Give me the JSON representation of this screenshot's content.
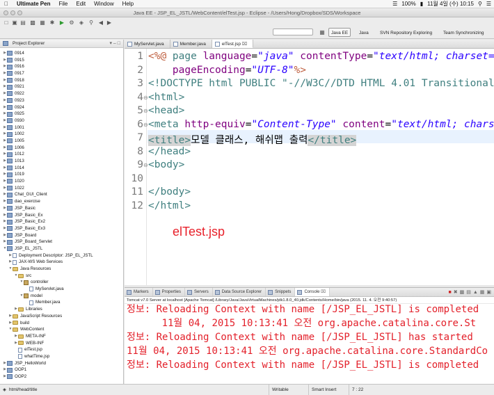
{
  "menubar": {
    "app": "Ultimate Pen",
    "items": [
      "File",
      "Edit",
      "Window",
      "Help"
    ],
    "battery": "100%",
    "datetime": "11월 4일 (수) 10:15"
  },
  "window": {
    "title": "Java EE - JSP_EL_JSTL/WebContent/elTest.jsp - Eclipse - /Users/Hong/Dropbox/SDS/Workspace"
  },
  "perspectives": [
    "Java EE",
    "Java",
    "SVN Repository Exploring",
    "Team Synchronizing"
  ],
  "explorer": {
    "title": "Project Explorer",
    "items": [
      {
        "label": "0914",
        "level": 0,
        "kind": "project"
      },
      {
        "label": "0915",
        "level": 0,
        "kind": "project"
      },
      {
        "label": "0916",
        "level": 0,
        "kind": "project"
      },
      {
        "label": "0917",
        "level": 0,
        "kind": "project"
      },
      {
        "label": "0918",
        "level": 0,
        "kind": "project"
      },
      {
        "label": "0921",
        "level": 0,
        "kind": "project"
      },
      {
        "label": "0922",
        "level": 0,
        "kind": "project"
      },
      {
        "label": "0923",
        "level": 0,
        "kind": "project"
      },
      {
        "label": "0924",
        "level": 0,
        "kind": "project"
      },
      {
        "label": "0925",
        "level": 0,
        "kind": "project"
      },
      {
        "label": "0930",
        "level": 0,
        "kind": "project"
      },
      {
        "label": "1001",
        "level": 0,
        "kind": "project"
      },
      {
        "label": "1002",
        "level": 0,
        "kind": "project"
      },
      {
        "label": "1005",
        "level": 0,
        "kind": "project"
      },
      {
        "label": "1006",
        "level": 0,
        "kind": "project"
      },
      {
        "label": "1012",
        "level": 0,
        "kind": "project"
      },
      {
        "label": "1013",
        "level": 0,
        "kind": "project"
      },
      {
        "label": "1014",
        "level": 0,
        "kind": "project"
      },
      {
        "label": "1019",
        "level": 0,
        "kind": "project"
      },
      {
        "label": "1020",
        "level": 0,
        "kind": "project"
      },
      {
        "label": "1022",
        "level": 0,
        "kind": "project"
      },
      {
        "label": "Chat_GUI_Client",
        "level": 0,
        "kind": "project"
      },
      {
        "label": "dao_exercise",
        "level": 0,
        "kind": "project"
      },
      {
        "label": "JSP_Basic",
        "level": 0,
        "kind": "project"
      },
      {
        "label": "JSP_Basic_Ex",
        "level": 0,
        "kind": "project"
      },
      {
        "label": "JSP_Basic_Ex2",
        "level": 0,
        "kind": "project"
      },
      {
        "label": "JSP_Basic_Ex3",
        "level": 0,
        "kind": "project"
      },
      {
        "label": "JSP_Board",
        "level": 0,
        "kind": "project"
      },
      {
        "label": "JSP_Board_Servlet",
        "level": 0,
        "kind": "project"
      },
      {
        "label": "JSP_EL_JSTL",
        "level": 0,
        "kind": "project",
        "open": true
      },
      {
        "label": "Deployment Descriptor: JSP_EL_JSTL",
        "level": 1,
        "kind": "file"
      },
      {
        "label": "JAX-WS Web Services",
        "level": 1,
        "kind": "file"
      },
      {
        "label": "Java Resources",
        "level": 1,
        "kind": "folder",
        "open": true
      },
      {
        "label": "src",
        "level": 2,
        "kind": "folder",
        "open": true
      },
      {
        "label": "controller",
        "level": 3,
        "kind": "package",
        "open": true
      },
      {
        "label": "MyServlet.java",
        "level": 4,
        "kind": "java"
      },
      {
        "label": "model",
        "level": 3,
        "kind": "package",
        "open": true
      },
      {
        "label": "Member.java",
        "level": 4,
        "kind": "java"
      },
      {
        "label": "Libraries",
        "level": 2,
        "kind": "folder"
      },
      {
        "label": "JavaScript Resources",
        "level": 1,
        "kind": "folder"
      },
      {
        "label": "build",
        "level": 1,
        "kind": "folder"
      },
      {
        "label": "WebContent",
        "level": 1,
        "kind": "folder",
        "open": true
      },
      {
        "label": "META-INF",
        "level": 2,
        "kind": "folder"
      },
      {
        "label": "WEB-INF",
        "level": 2,
        "kind": "folder"
      },
      {
        "label": "elTest.jsp",
        "level": 2,
        "kind": "java"
      },
      {
        "label": "whatTime.jsp",
        "level": 2,
        "kind": "java"
      },
      {
        "label": "JSP_HelloWorld",
        "level": 0,
        "kind": "project"
      },
      {
        "label": "OOP1",
        "level": 0,
        "kind": "project"
      },
      {
        "label": "OOP2",
        "level": 0,
        "kind": "project"
      }
    ]
  },
  "editor": {
    "tabs": [
      "MyServlet.java",
      "Member.java",
      "elTest.jsp"
    ],
    "active_tab": "elTest.jsp",
    "annotation": "elTest.jsp",
    "lines": [
      "1",
      "2",
      "3",
      "4",
      "5",
      "6",
      "7",
      "8",
      "9",
      "10",
      "11",
      "12"
    ],
    "code": {
      "l1a": "<%@ ",
      "l1b": "page ",
      "l1c": "language",
      "l1d": "=",
      "l1e": "\"java\"",
      "l1f": " contentType",
      "l1g": "=",
      "l1h": "\"text/html; charset=",
      "l2a": "    pageEncoding",
      "l2b": "=",
      "l2c": "\"UTF-8\"",
      "l2d": "%>",
      "l3": "<!DOCTYPE html PUBLIC \"-//W3C//DTD HTML 4.01 Transitional",
      "l4": "<html>",
      "l5": "<head>",
      "l6a": "<meta ",
      "l6b": "http-equiv",
      "l6c": "=",
      "l6d": "\"Content-Type\"",
      "l6e": " content",
      "l6f": "=",
      "l6g": "\"text/html; chars",
      "l7a": "<title>",
      "l7b": "모델 클래스, 해쉬맵 출력",
      "l7c": "</title>",
      "l8": "</head>",
      "l9": "<body>",
      "l11": "</body>",
      "l12": "</html>"
    }
  },
  "bottom": {
    "tabs": [
      "Markers",
      "Properties",
      "Servers",
      "Data Source Explorer",
      "Snippets",
      "Console"
    ],
    "active_tab": "Console",
    "console_header": "Tomcat v7.0 Server at localhost [Apache Tomcat] /Library/Java/JavaVirtualMachines/jdk1.8.0_40.jdk/Contents/Home/bin/java (2015. 11. 4. 오전 9:40:57)",
    "lines": [
      "정보: Reloading Context with name [/JSP_EL_JSTL] is completed",
      "      11월 04, 2015 10:13:41 오전 org.apache.catalina.core.St",
      "정보: Reloading Context with name [/JSP_EL_JSTL] has started",
      "11월 04, 2015 10:13:41 오전 org.apache.catalina.core.StandardCo",
      "정보: Reloading Context with name [/JSP_EL_JSTL] is completed"
    ]
  },
  "status": {
    "path": "html/head/title",
    "mode": "Writable",
    "insert": "Smart Insert",
    "position": "7 : 22"
  }
}
